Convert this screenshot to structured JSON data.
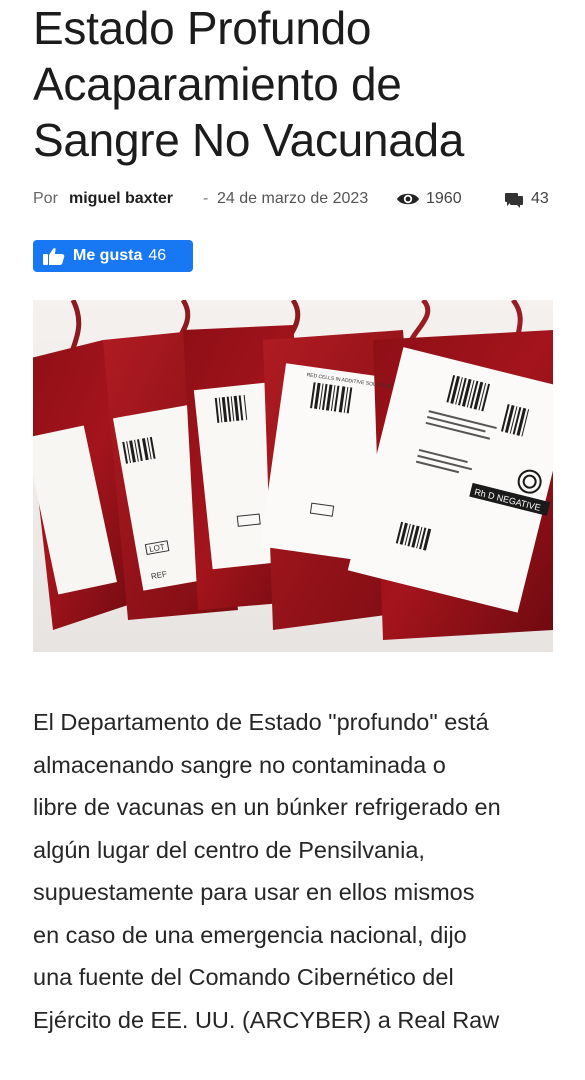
{
  "article": {
    "title_lines": [
      "Estado Profundo",
      "Acaparamiento de",
      "Sangre No Vacunada"
    ],
    "meta": {
      "by_label": "Por",
      "author": "miguel baxter",
      "separator": "-",
      "date": "24 de marzo de 2023",
      "views": "1960",
      "comments": "43",
      "views_icon": "eye-icon",
      "comments_icon": "comment-icon"
    },
    "like_button": {
      "label": "Me gusta",
      "count": "46",
      "icon": "thumbs-up-icon",
      "color": "#1877f2"
    },
    "image": {
      "label_texts": [
        "RED CELLS IN ADDITIVE SOLUTION",
        "Rh D NEGATIVE",
        "LOT",
        "REF"
      ]
    },
    "body_lines": [
      "El Departamento de Estado \"profundo\" está",
      "almacenando sangre no contaminada o",
      "libre de vacunas en un búnker refrigerado en",
      "algún lugar del centro de Pensilvania,",
      "supuestamente para usar en ellos mismos",
      "en caso de una emergencia nacional, dijo",
      "una fuente del Comando Cibernético del",
      "Ejército de EE. UU. (ARCYBER) a Real Raw"
    ]
  }
}
